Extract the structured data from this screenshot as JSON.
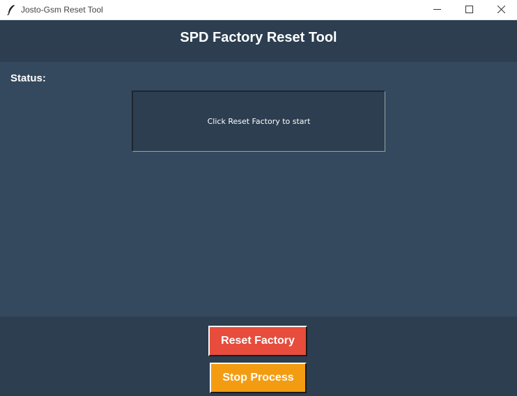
{
  "window": {
    "title": "Josto-Gsm Reset Tool",
    "icon": "feather-icon",
    "controls": [
      "minimize-icon",
      "maximize-icon",
      "close-icon"
    ]
  },
  "header": {
    "title": "SPD Factory Reset Tool"
  },
  "status": {
    "label": "Status:",
    "message": "Click Reset Factory to start"
  },
  "actions": {
    "reset_label": "Reset Factory",
    "stop_label": "Stop Process"
  },
  "colors": {
    "header_bg": "#2c3e50",
    "main_bg": "#34495e",
    "reset_button": "#e74c3c",
    "stop_button": "#f39c12",
    "text": "#ffffff"
  }
}
